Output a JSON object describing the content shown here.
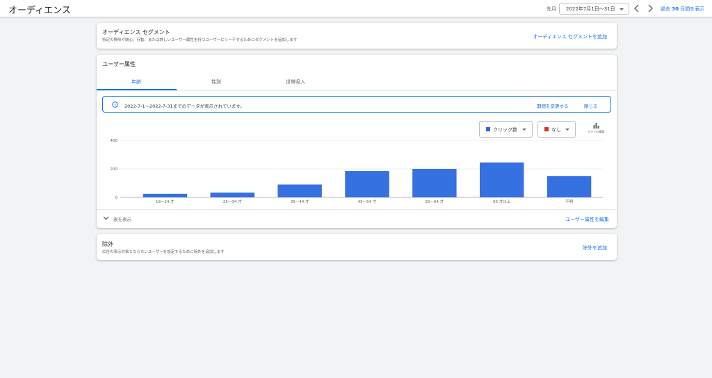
{
  "header": {
    "title": "オーディエンス",
    "period_label": "先月",
    "date_range": "2022年7月1日〜31日",
    "last30_prefix": "過去 ",
    "last30_bold": "30",
    "last30_suffix": " 日間を表示"
  },
  "segments_card": {
    "title": "オーディエンス セグメント",
    "subtitle": "特定の興味や関心、行動、または詳しいユーザー属性を持つユーザーにリーチするためにセグメントを追加します",
    "action": "オーディエンス セグメントを追加"
  },
  "demographics_card": {
    "title": "ユーザー属性",
    "tabs": [
      {
        "label": "年齢",
        "active": true
      },
      {
        "label": "性別",
        "active": false
      },
      {
        "label": "世帯収入",
        "active": false
      }
    ],
    "banner": {
      "message": "2022-7-1〜2022-7-31までのデータが表示されています。",
      "change_period": "期間を変更する",
      "close": "閉じる"
    },
    "metric_select": {
      "label": "クリック数",
      "color": "#3367d6"
    },
    "compare_select": {
      "label": "なし",
      "color": "#d93025"
    },
    "chart_type_label": "グラフの種類",
    "show_table": "表を表示",
    "edit_demographics": "ユーザー属性を編集"
  },
  "exclusions_card": {
    "title": "除外",
    "subtitle": "広告の表示対象とならないユーザーを設定するために除外を追加します",
    "action": "除外を追加"
  },
  "chart_data": {
    "type": "bar",
    "categories": [
      "18〜24 才",
      "25〜34 才",
      "35〜44 才",
      "45〜54 才",
      "55〜64 才",
      "65 才以上",
      "不明"
    ],
    "series": [
      {
        "name": "クリック数",
        "values": [
          25,
          33,
          90,
          185,
          200,
          245,
          150
        ]
      }
    ],
    "yticks": [
      0,
      200,
      400
    ],
    "ylim": [
      0,
      400
    ],
    "grid": true,
    "bar_color": "#3571e0"
  }
}
